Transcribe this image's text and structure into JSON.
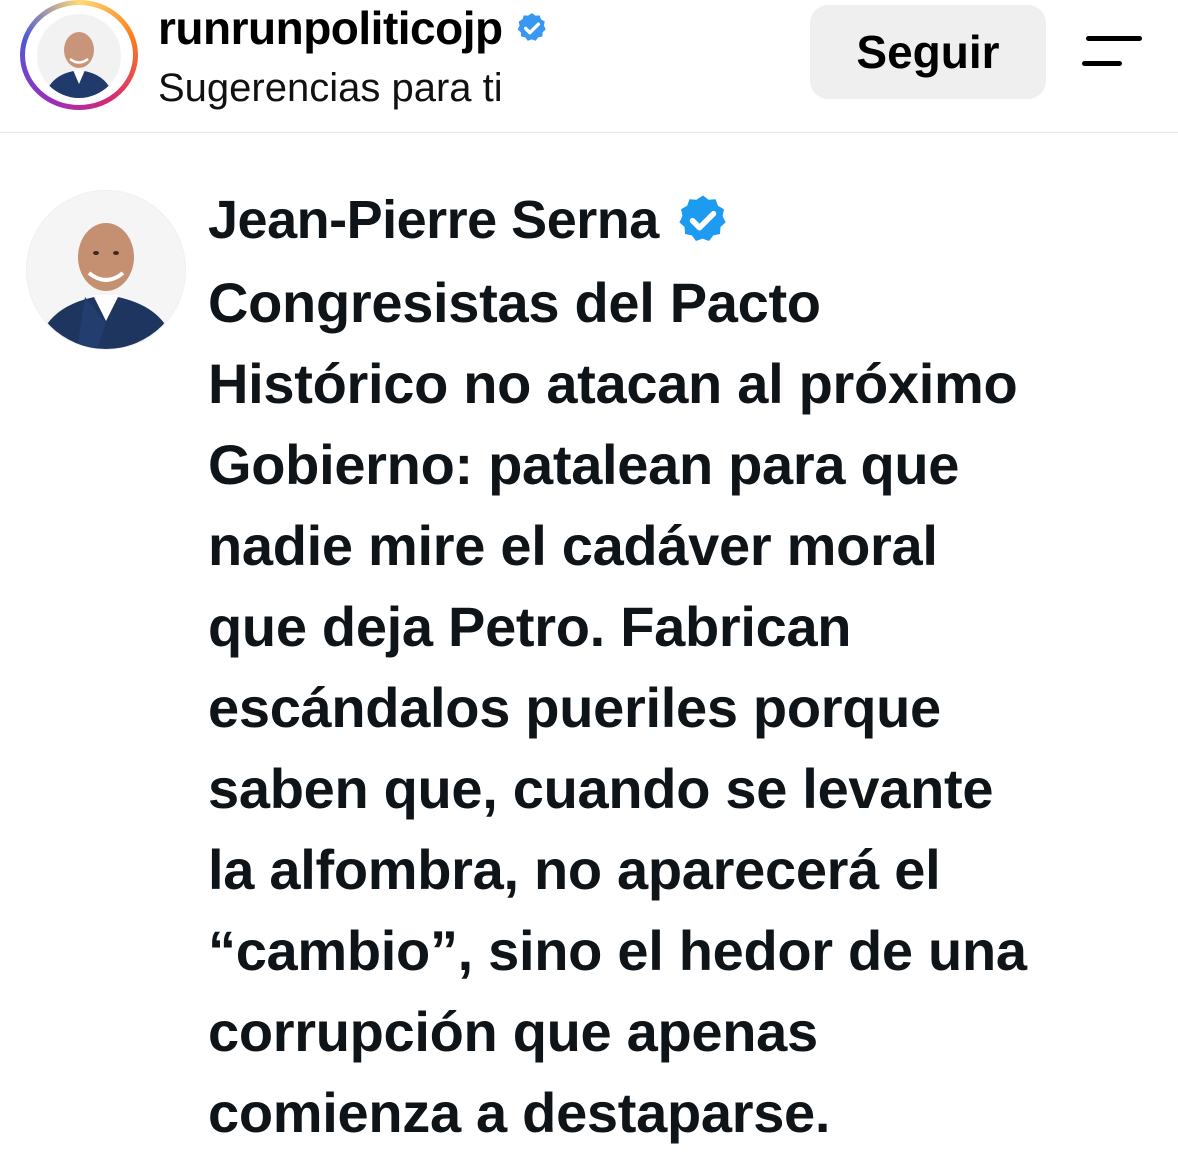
{
  "header": {
    "username": "runrunpoliticojp",
    "subtitle": "Sugerencias para ti",
    "follow_label": "Seguir",
    "verified": true
  },
  "tweet": {
    "author_name": "Jean-Pierre Serna",
    "verified": true,
    "text_lines": [
      "Congresistas del Pacto",
      "Histórico no atacan al próximo",
      "Gobierno: patalean para que",
      "nadie mire el cadáver moral",
      "que deja Petro. Fabrican",
      "escándalos pueriles porque",
      "saben que, cuando se levante",
      "la alfombra, no aparecerá el",
      "“cambio”, sino el hedor de una",
      "corrupción que apenas",
      "comienza a destaparse."
    ]
  },
  "colors": {
    "verified_blue": "#1d9bf0",
    "follow_bg": "#efefef",
    "divider": "#e6e6e6",
    "text": "#0f1419"
  },
  "icons": {
    "verified": "verified-badge-icon",
    "menu": "menu-icon"
  }
}
